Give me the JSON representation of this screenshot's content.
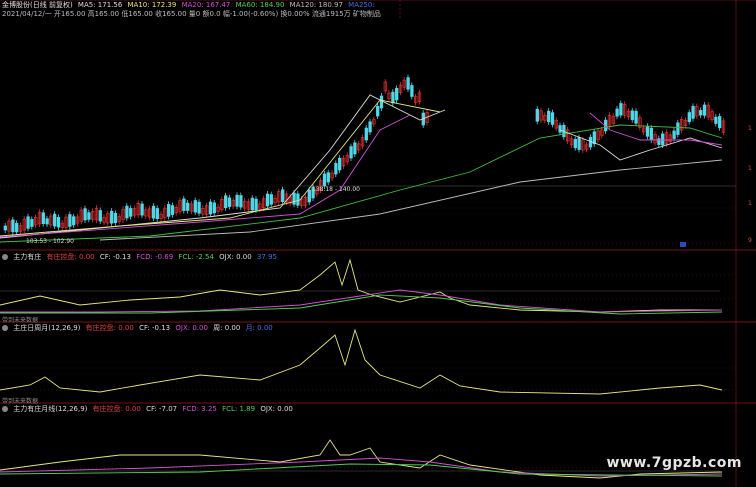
{
  "header": {
    "title": "金博股份(日线 前复权)",
    "ma5": "MA5: 171.56",
    "ma10": "MA10: 172.39",
    "ma20": "MA20: 167.47",
    "ma60": "MA60: 184.90",
    "ma120": "MA120: 180.97",
    "ma250": "MA250:",
    "ohlc": "2021/04/12/一 开165.00 高165.00 低165.00 收165.00 量0 额0.0 幅-1.00(-0.60%) 换0.00% 流通1915万 矿物制品"
  },
  "price_labels": {
    "high_mark": "138.18 - 140.00",
    "low_mark": "103.53 - 102.90"
  },
  "panel1": {
    "title": "主力有庄",
    "items": [
      {
        "text": "有庄控盘: 0.00",
        "color": "#e04040"
      },
      {
        "text": "CF: -0.13",
        "color": "#dddddd"
      },
      {
        "text": "FCD: -0.69",
        "color": "#d050d0"
      },
      {
        "text": "FCL: -2.54",
        "color": "#50d050"
      },
      {
        "text": "OJX: 0.00",
        "color": "#dddddd"
      },
      {
        "text": "37.95",
        "color": "#3a70e0"
      }
    ],
    "note": "带到未来数据"
  },
  "panel2": {
    "title": "主庄日周月(12,26,9)",
    "items": [
      {
        "text": "有庄控盘: 0.00",
        "color": "#e04040"
      },
      {
        "text": "CF: -0.13",
        "color": "#dddddd"
      },
      {
        "text": "OJX: 0.00",
        "color": "#d050d0"
      },
      {
        "text": "周: 0.00",
        "color": "#dddddd"
      },
      {
        "text": "月: 0.00",
        "color": "#3a70e0"
      }
    ],
    "note": "带到未来数据"
  },
  "panel3": {
    "title": "主力有庄月线(12,26,9)",
    "items": [
      {
        "text": "有庄控盘: 0.00",
        "color": "#e04040"
      },
      {
        "text": "CF: -7.07",
        "color": "#dddddd"
      },
      {
        "text": "FCD: 3.25",
        "color": "#d050d0"
      },
      {
        "text": "FCL: 1.89",
        "color": "#50d050"
      },
      {
        "text": "OJX: 0.00",
        "color": "#dddddd"
      }
    ]
  },
  "watermark": "www.7gpzb.com",
  "colors": {
    "up": "#e03030",
    "down": "#50d8e8",
    "ma5": "#dddddd",
    "ma10": "#e6e680",
    "ma20": "#d050d0",
    "ma60": "#40c040",
    "ma120": "#bbbbbb",
    "grid": "#5a1010"
  }
}
